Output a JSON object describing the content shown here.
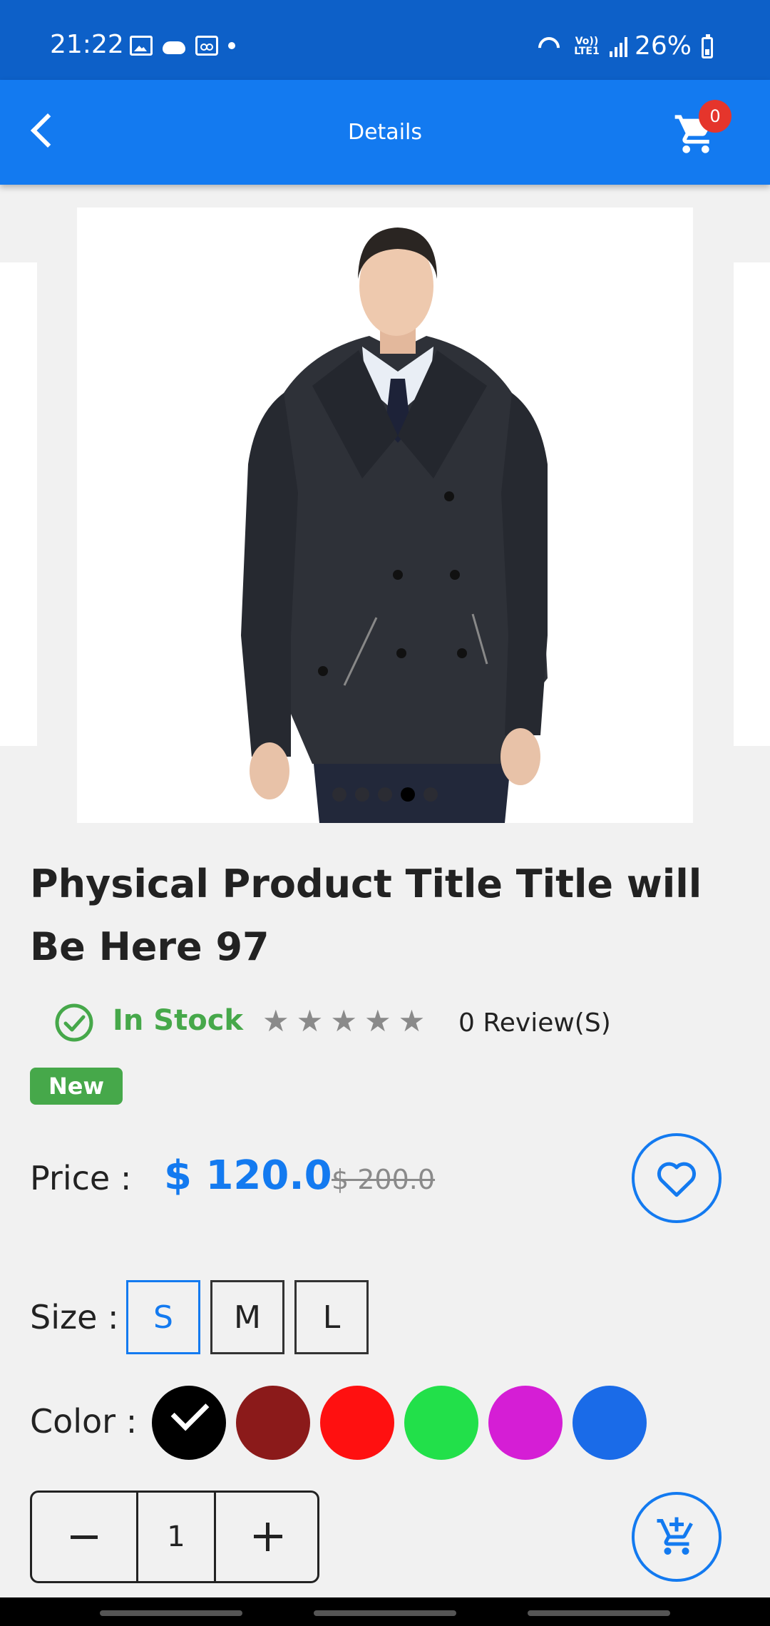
{
  "status_bar": {
    "time": "21:22",
    "network_label": "Vo)) LTE1",
    "battery": "26%",
    "icons": [
      "gallery-icon",
      "cloud-icon",
      "voicemail-icon",
      "dot-icon",
      "wifi-icon",
      "signal-icon",
      "battery-icon"
    ]
  },
  "app_bar": {
    "title": "Details",
    "back_icon": "back-arrow-icon",
    "cart_icon": "cart-icon",
    "cart_count": "0"
  },
  "carousel": {
    "total_slides": 5,
    "active_index": 3
  },
  "product": {
    "title": "Physical Product Title Title will Be Here 97",
    "stock_status": "In Stock",
    "rating": 0,
    "rating_max": 5,
    "reviews_label": "0 Review(S)",
    "badge": "New",
    "price_label": "Price :",
    "price": "$ 120.0",
    "old_price": "$ 200.0",
    "size_label": "Size :",
    "sizes": [
      "S",
      "M",
      "L"
    ],
    "selected_size": "S",
    "color_label": "Color :",
    "colors": [
      "#000000",
      "#8b1a1a",
      "#ff1010",
      "#22e04a",
      "#d51ed5",
      "#1a6be8"
    ],
    "selected_color_index": 0,
    "quantity": "1"
  },
  "colors": {
    "primary": "#137af0",
    "status_bar": "#0d60c8",
    "in_stock": "#46a84a",
    "badge_red": "#e5352c"
  }
}
